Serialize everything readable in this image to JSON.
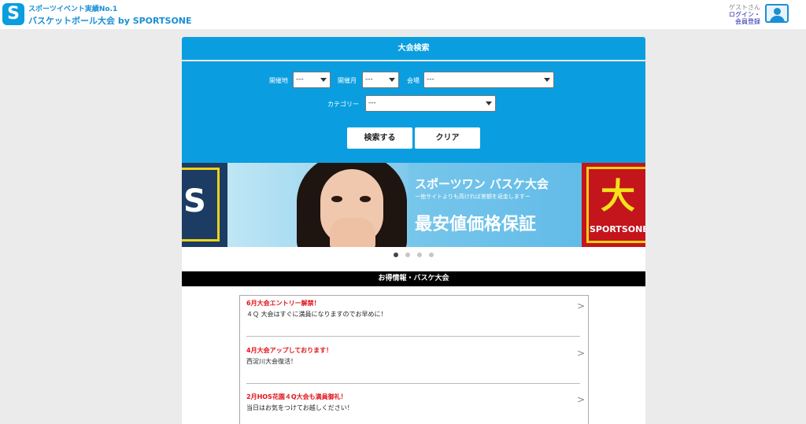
{
  "header": {
    "logo_letter": "S",
    "tagline": "スポーツイベント実績No.1",
    "site_title": "バスケットボール大会 by SPORTSONE",
    "guest_label": "ゲストさん",
    "login_label": "ログイン・",
    "register_label": "会員登録"
  },
  "search": {
    "title": "大会検索",
    "venue_region_label": "開催地",
    "venue_region_value": "---",
    "month_label": "開催月",
    "month_value": "---",
    "venue_label": "会場",
    "venue_value": "---",
    "category_label": "カテゴリー",
    "category_value": "---",
    "search_button": "検索する",
    "clear_button": "クリア"
  },
  "banner": {
    "left_glyph": "S",
    "title": "スポーツワン バスケ大会",
    "subtitle": "ー他サイトよりも高ければ差額を返金しますー",
    "guarantee": "最安値価格保証",
    "right_big": "大",
    "right_brand": "SPORTSONE",
    "slide_count": 4,
    "active_slide": 1
  },
  "info": {
    "heading": "お得情報・バスケ大会",
    "items": [
      {
        "title": "6月大会エントリー解禁！",
        "body": "４Ｑ 大会はすぐに満員になりますのでお早めに！"
      },
      {
        "title": "4月大会アップしております！",
        "body": "西淀川大会復活！"
      },
      {
        "title": "2月HOS花園４Q大会も満員御礼！",
        "body": "当日はお気をつけてお越しください！"
      }
    ],
    "chevron": ">"
  },
  "colors": {
    "brand_blue": "#0a9ee0",
    "alert_red": "#e0141c",
    "page_bg": "#ebebeb"
  }
}
